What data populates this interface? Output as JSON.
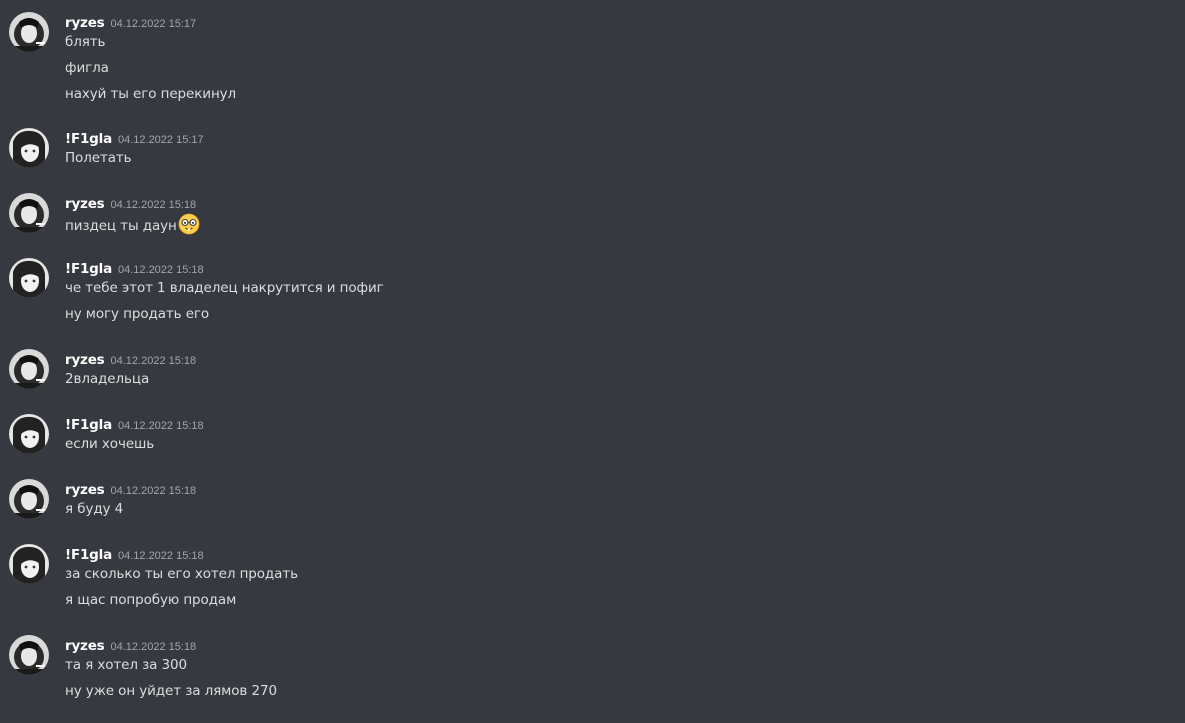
{
  "messages": [
    {
      "username": "ryzes",
      "timestamp": "04.12.2022 15:17",
      "avatar": "ryzes-avatar",
      "lines": [
        "блять",
        "фигла",
        "нахуй ты его перекинул"
      ]
    },
    {
      "username": "!F1gla",
      "timestamp": "04.12.2022 15:17",
      "avatar": "f1gla-avatar",
      "lines": [
        "Полетать"
      ]
    },
    {
      "username": "ryzes",
      "timestamp": "04.12.2022 15:18",
      "avatar": "ryzes-avatar",
      "lines": [
        "пиздец ты даун"
      ],
      "emoji": "nerd-face-emoji"
    },
    {
      "username": "!F1gla",
      "timestamp": "04.12.2022 15:18",
      "avatar": "f1gla-avatar",
      "lines": [
        "че тебе этот 1 владелец накрутится и пофиг",
        "ну могу продать его"
      ]
    },
    {
      "username": "ryzes",
      "timestamp": "04.12.2022 15:18",
      "avatar": "ryzes-avatar",
      "lines": [
        "2владельца"
      ]
    },
    {
      "username": "!F1gla",
      "timestamp": "04.12.2022 15:18",
      "avatar": "f1gla-avatar",
      "lines": [
        "если хочешь"
      ]
    },
    {
      "username": "ryzes",
      "timestamp": "04.12.2022 15:18",
      "avatar": "ryzes-avatar",
      "lines": [
        "я буду 4"
      ]
    },
    {
      "username": "!F1gla",
      "timestamp": "04.12.2022 15:18",
      "avatar": "f1gla-avatar",
      "lines": [
        "за сколько ты его хотел продать",
        "я щас попробую продам"
      ]
    },
    {
      "username": "ryzes",
      "timestamp": "04.12.2022 15:18",
      "avatar": "ryzes-avatar",
      "lines": [
        "та я хотел за 300",
        "ну уже он уйдет за лямов 270"
      ]
    }
  ],
  "colors": {
    "background": "#36393f",
    "username": "#ffffff",
    "timestamp": "#a3a6aa",
    "message_text": "#dcddde"
  }
}
